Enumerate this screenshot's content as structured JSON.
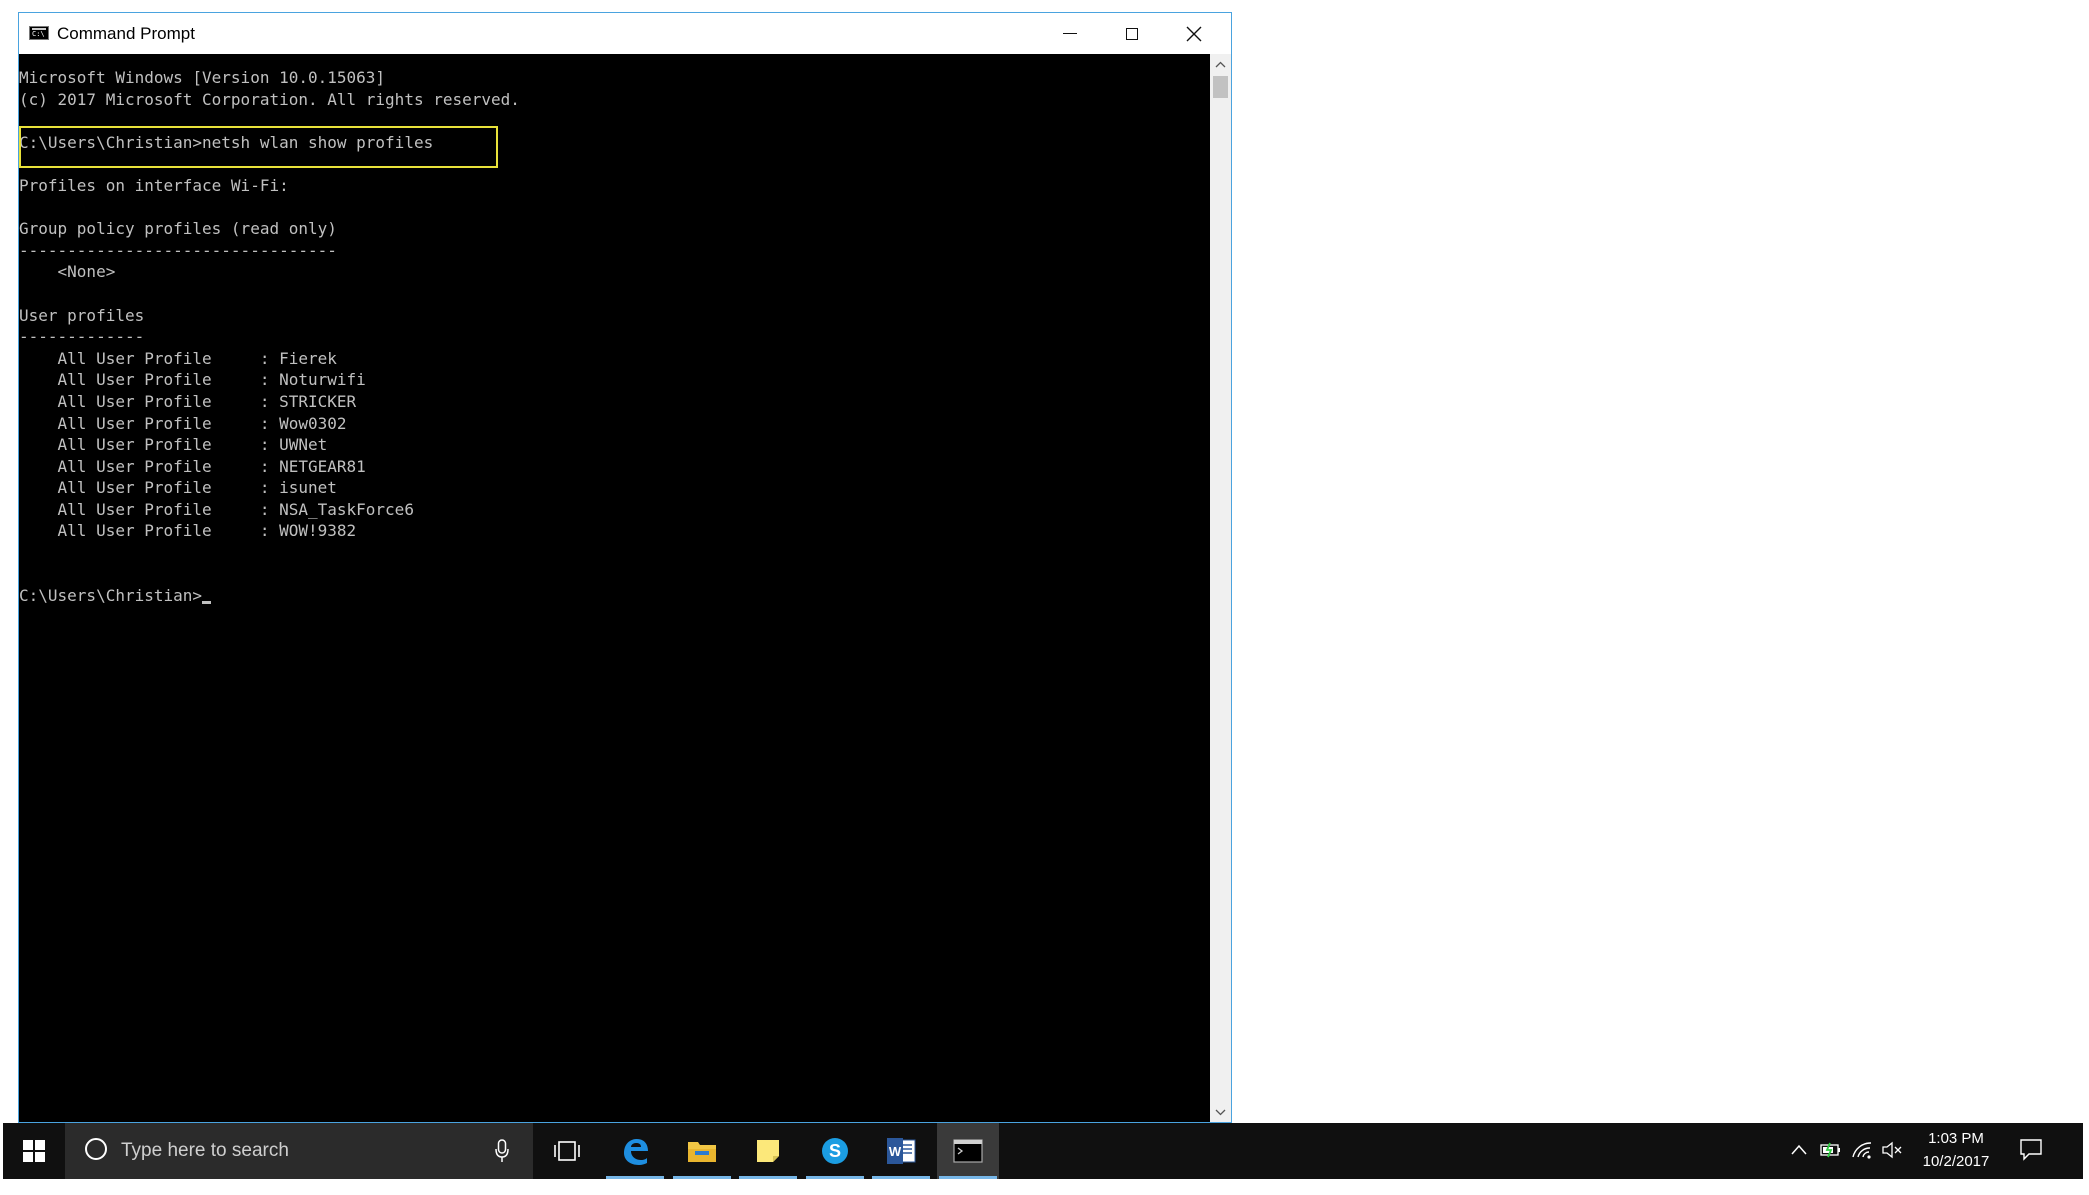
{
  "window": {
    "title": "Command Prompt",
    "icon": "console-icon",
    "icon_glyph": "C:\\"
  },
  "console": {
    "lines": [
      "Microsoft Windows [Version 10.0.15063]",
      "(c) 2017 Microsoft Corporation. All rights reserved.",
      "",
      "C:\\Users\\Christian>netsh wlan show profiles",
      "",
      "Profiles on interface Wi-Fi:",
      "",
      "Group policy profiles (read only)",
      "---------------------------------",
      "    <None>",
      "",
      "User profiles",
      "-------------",
      "    All User Profile     : Fierek",
      "    All User Profile     : Noturwifi",
      "    All User Profile     : STRICKER",
      "    All User Profile     : Wow0302",
      "    All User Profile     : UWNet",
      "    All User Profile     : NETGEAR81",
      "    All User Profile     : isunet",
      "    All User Profile     : NSA_TaskForce6",
      "    All User Profile     : WOW!9382",
      "",
      "",
      "C:\\Users\\Christian>"
    ],
    "highlighted_command": "C:\\Users\\Christian>netsh wlan show profiles",
    "highlight_color": "#e9e23a"
  },
  "taskbar": {
    "search_placeholder": "Type here to search",
    "apps": [
      "task-view-icon",
      "edge-icon",
      "file-explorer-icon",
      "sticky-notes-icon",
      "skype-icon",
      "word-icon",
      "command-prompt-icon"
    ],
    "active_app": "command-prompt-icon",
    "accent": "#77b7e8"
  },
  "tray": {
    "time": "1:03 PM",
    "date": "10/2/2017",
    "icons": [
      "chevron-up-icon",
      "battery-icon",
      "wifi-icon",
      "volume-muted-icon",
      "action-center-icon"
    ]
  }
}
